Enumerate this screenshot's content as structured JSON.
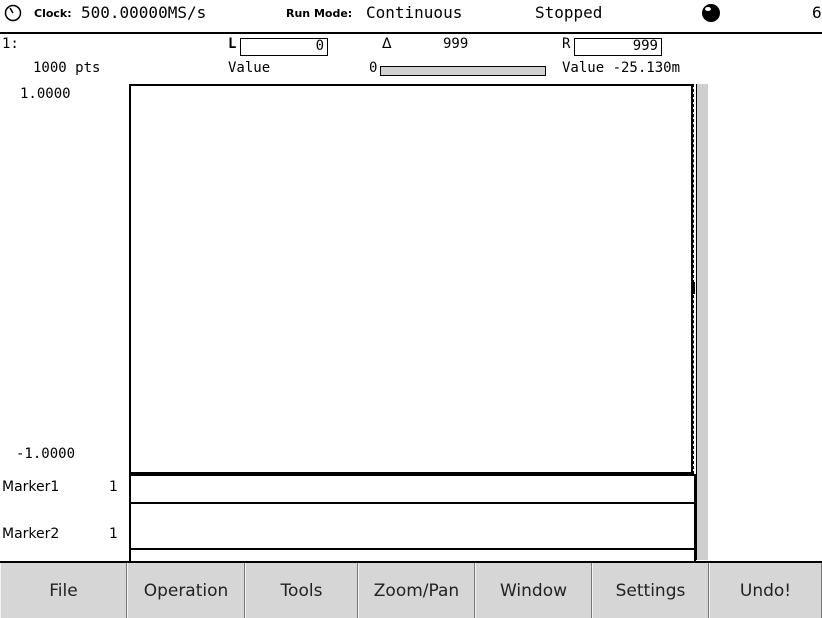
{
  "status_bar": {
    "clock_label": "Clock:",
    "clock_value": "500.00000MS/s",
    "run_mode_label": "Run Mode:",
    "run_mode_value": "Continuous",
    "state": "Stopped",
    "indicator_icon": "status-ball-icon",
    "trailing_text": "6"
  },
  "header": {
    "channel": "1:",
    "points": "1000 pts",
    "left_label": "L",
    "left_value": "0",
    "left_value_label": "Value",
    "delta_symbol": "Δ",
    "delta_value": "999",
    "progress_min": "0",
    "progress_fraction": 0,
    "right_label": "R",
    "right_value": "999",
    "right_value_text": "Value -25.130m"
  },
  "plot": {
    "y_max": "1.0000",
    "y_min": "-1.0000"
  },
  "markers": [
    {
      "label": "Marker1",
      "value": "1"
    },
    {
      "label": "Marker2",
      "value": "1"
    }
  ],
  "menu": [
    "File",
    "Operation",
    "Tools",
    "Zoom/Pan",
    "Window",
    "Settings",
    "Undo!"
  ],
  "colors": {
    "menu_bg": "#d6d6d6",
    "scroll_strip": "#cfcfcf"
  }
}
